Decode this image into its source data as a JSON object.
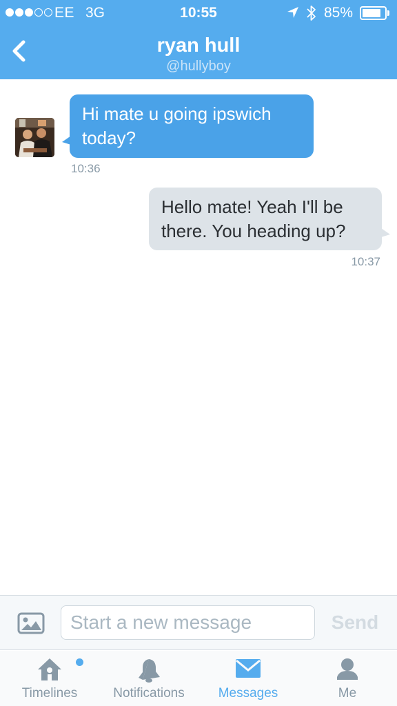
{
  "status_bar": {
    "carrier": "EE",
    "network": "3G",
    "time": "10:55",
    "battery_percent": "85%",
    "battery_level": 0.85,
    "signal_bars_filled": 3,
    "signal_bars_total": 5
  },
  "nav": {
    "title": "ryan hull",
    "handle": "@hullyboy",
    "back_icon": "chevron-left-icon"
  },
  "messages": [
    {
      "direction": "incoming",
      "text": "Hi mate u going ipswich today?",
      "time": "10:36"
    },
    {
      "direction": "outgoing",
      "text": "Hello mate! Yeah I'll be there. You heading up?",
      "time": "10:37"
    }
  ],
  "composer": {
    "placeholder": "Start a new message",
    "send_label": "Send",
    "photo_icon": "photo-icon"
  },
  "tabs": [
    {
      "label": "Timelines",
      "icon": "home-icon",
      "active": false,
      "has_indicator": true
    },
    {
      "label": "Notifications",
      "icon": "bell-icon",
      "active": false
    },
    {
      "label": "Messages",
      "icon": "envelope-icon",
      "active": true
    },
    {
      "label": "Me",
      "icon": "person-icon",
      "active": false
    }
  ],
  "colors": {
    "brand": "#55acee",
    "incoming_bubble": "#4aa2e8",
    "outgoing_bubble": "#dde3e8",
    "muted_text": "#8899a6"
  }
}
